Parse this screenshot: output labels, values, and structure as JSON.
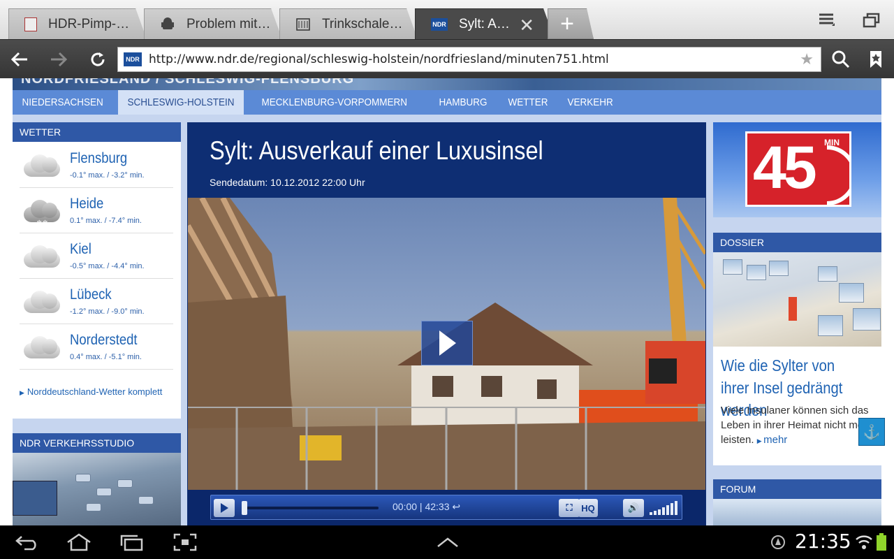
{
  "browser": {
    "tabs": [
      {
        "title": "HDR-Pimp-…",
        "favicon": "document-icon"
      },
      {
        "title": "Problem mit…",
        "favicon": "android-icon"
      },
      {
        "title": "Trinkschale…",
        "favicon": "building-icon"
      },
      {
        "title": "Sylt: A…",
        "favicon": "ndr-icon",
        "active": true
      }
    ],
    "new_tab_label": "+",
    "url": "http://www.ndr.de/regional/schleswig-holstein/nordfriesland/minuten751.html",
    "favicon_label": "NDR"
  },
  "site": {
    "banner_text": "NORDFRIESLAND / SCHLESWIG-FLENSBURG",
    "nav": [
      "NIEDERSACHSEN",
      "SCHLESWIG-HOLSTEIN",
      "MECKLENBURG-VORPOMMERN",
      "HAMBURG",
      "WETTER",
      "VERKEHR"
    ],
    "nav_active": "SCHLESWIG-HOLSTEIN"
  },
  "weather": {
    "heading": "WETTER",
    "cities": [
      {
        "name": "Flensburg",
        "temps": "-0.1° max. / -3.2° min.",
        "icon": "cloud-icon"
      },
      {
        "name": "Heide",
        "temps": "0.1° max. / -7.4° min.",
        "icon": "snow-cloud-icon"
      },
      {
        "name": "Kiel",
        "temps": "-0.5° max. / -4.4° min.",
        "icon": "cloud-icon"
      },
      {
        "name": "Lübeck",
        "temps": "-1.2° max. / -9.0° min.",
        "icon": "cloud-icon"
      },
      {
        "name": "Norderstedt",
        "temps": "0.4° max. / -5.1° min.",
        "icon": "cloud-icon"
      }
    ],
    "link": "Norddeutschland-Wetter komplett"
  },
  "traffic": {
    "heading": "NDR VERKEHRSSTUDIO"
  },
  "video": {
    "title": "Sylt: Ausverkauf einer Luxusinsel",
    "date": "Sendedatum: 10.12.2012 22:00 Uhr",
    "current_time": "00:00",
    "duration": "42:33",
    "hq_label": "HQ",
    "progress": 0
  },
  "promo": {
    "number": "45",
    "unit": "MIN"
  },
  "dossier": {
    "heading": "DOSSIER",
    "title": "Wie die Sylter von ihrer Insel gedrängt werden",
    "text": "Viele Insulaner können sich das Leben in ihrer Heimat nicht mehr leisten.",
    "more": "mehr"
  },
  "forum": {
    "heading": "FORUM"
  },
  "system": {
    "clock": "21:35"
  }
}
